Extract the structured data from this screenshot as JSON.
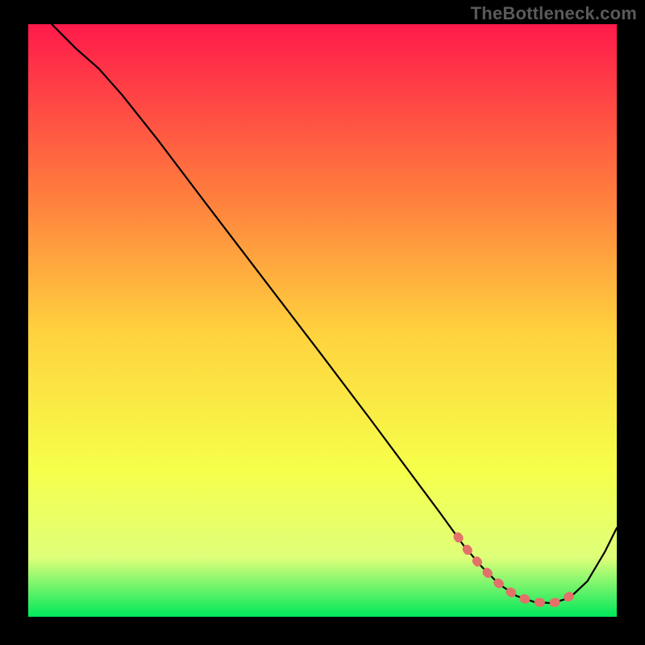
{
  "watermark": "TheBottleneck.com",
  "chart_data": {
    "type": "line",
    "title": "",
    "xlabel": "",
    "ylabel": "",
    "xlim": [
      0,
      100
    ],
    "ylim": [
      0,
      100
    ],
    "grid": false,
    "series": [
      {
        "name": "curve",
        "x": [
          4,
          8,
          12,
          16,
          22,
          30,
          40,
          50,
          58,
          64,
          70,
          74,
          77,
          80,
          83,
          86,
          89,
          92,
          95,
          98,
          100
        ],
        "y": [
          100,
          96,
          92.5,
          88,
          80.5,
          70,
          57,
          44,
          33.5,
          25.5,
          17.5,
          12,
          8.5,
          5.5,
          3.5,
          2.5,
          2.3,
          3.2,
          6,
          11,
          15
        ]
      },
      {
        "name": "highlight",
        "x": [
          73,
          75,
          77,
          79,
          81,
          83,
          85,
          87,
          89,
          91,
          93
        ],
        "y": [
          13.5,
          10.8,
          8.5,
          6.4,
          4.8,
          3.5,
          2.8,
          2.4,
          2.3,
          2.8,
          4.2
        ]
      }
    ],
    "colors": {
      "curve": "#000000",
      "highlight": "#e4706a",
      "gradient_top": "#ff1a4b",
      "gradient_mid_upper": "#ff7a3e",
      "gradient_mid": "#ffd23e",
      "gradient_mid_lower": "#f6ff4a",
      "gradient_lower": "#dfff7a",
      "gradient_bottom": "#00e85b"
    }
  }
}
